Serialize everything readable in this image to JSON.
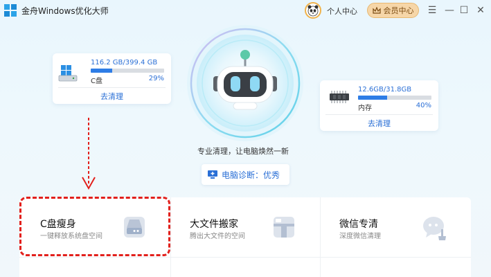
{
  "app": {
    "title": "金舟Windows优化大师"
  },
  "header": {
    "user_label": "个人中心",
    "vip_label": "会员中心"
  },
  "window_controls": {
    "menu": "☰",
    "minimize": "—",
    "maximize": "☐",
    "close": "✕"
  },
  "disk_card": {
    "usage": "116.2 GB/399.4 GB",
    "name": "C盘",
    "percent": "29%",
    "clean_label": "去清理",
    "fill": 0.29
  },
  "memory_card": {
    "usage": "12.6GB/31.8GB",
    "name": "内存",
    "percent": "40%",
    "clean_label": "去清理",
    "fill": 0.4
  },
  "main": {
    "slogan": "专业清理，让电脑焕然一新",
    "diagnosis_label": "电脑诊断：优秀"
  },
  "features": [
    {
      "title": "C盘瘦身",
      "desc": "一键释放系统盘空间",
      "icon": "disk-icon"
    },
    {
      "title": "大文件搬家",
      "desc": "腾出大文件的空间",
      "icon": "box-icon"
    },
    {
      "title": "微信专清",
      "desc": "深度微信清理",
      "icon": "chat-clean-icon"
    }
  ],
  "colors": {
    "accent": "#2a6fd6",
    "bar_fill": "#2e7de6",
    "highlight": "#e2201c",
    "vip_bg": "#f6d6a8"
  }
}
